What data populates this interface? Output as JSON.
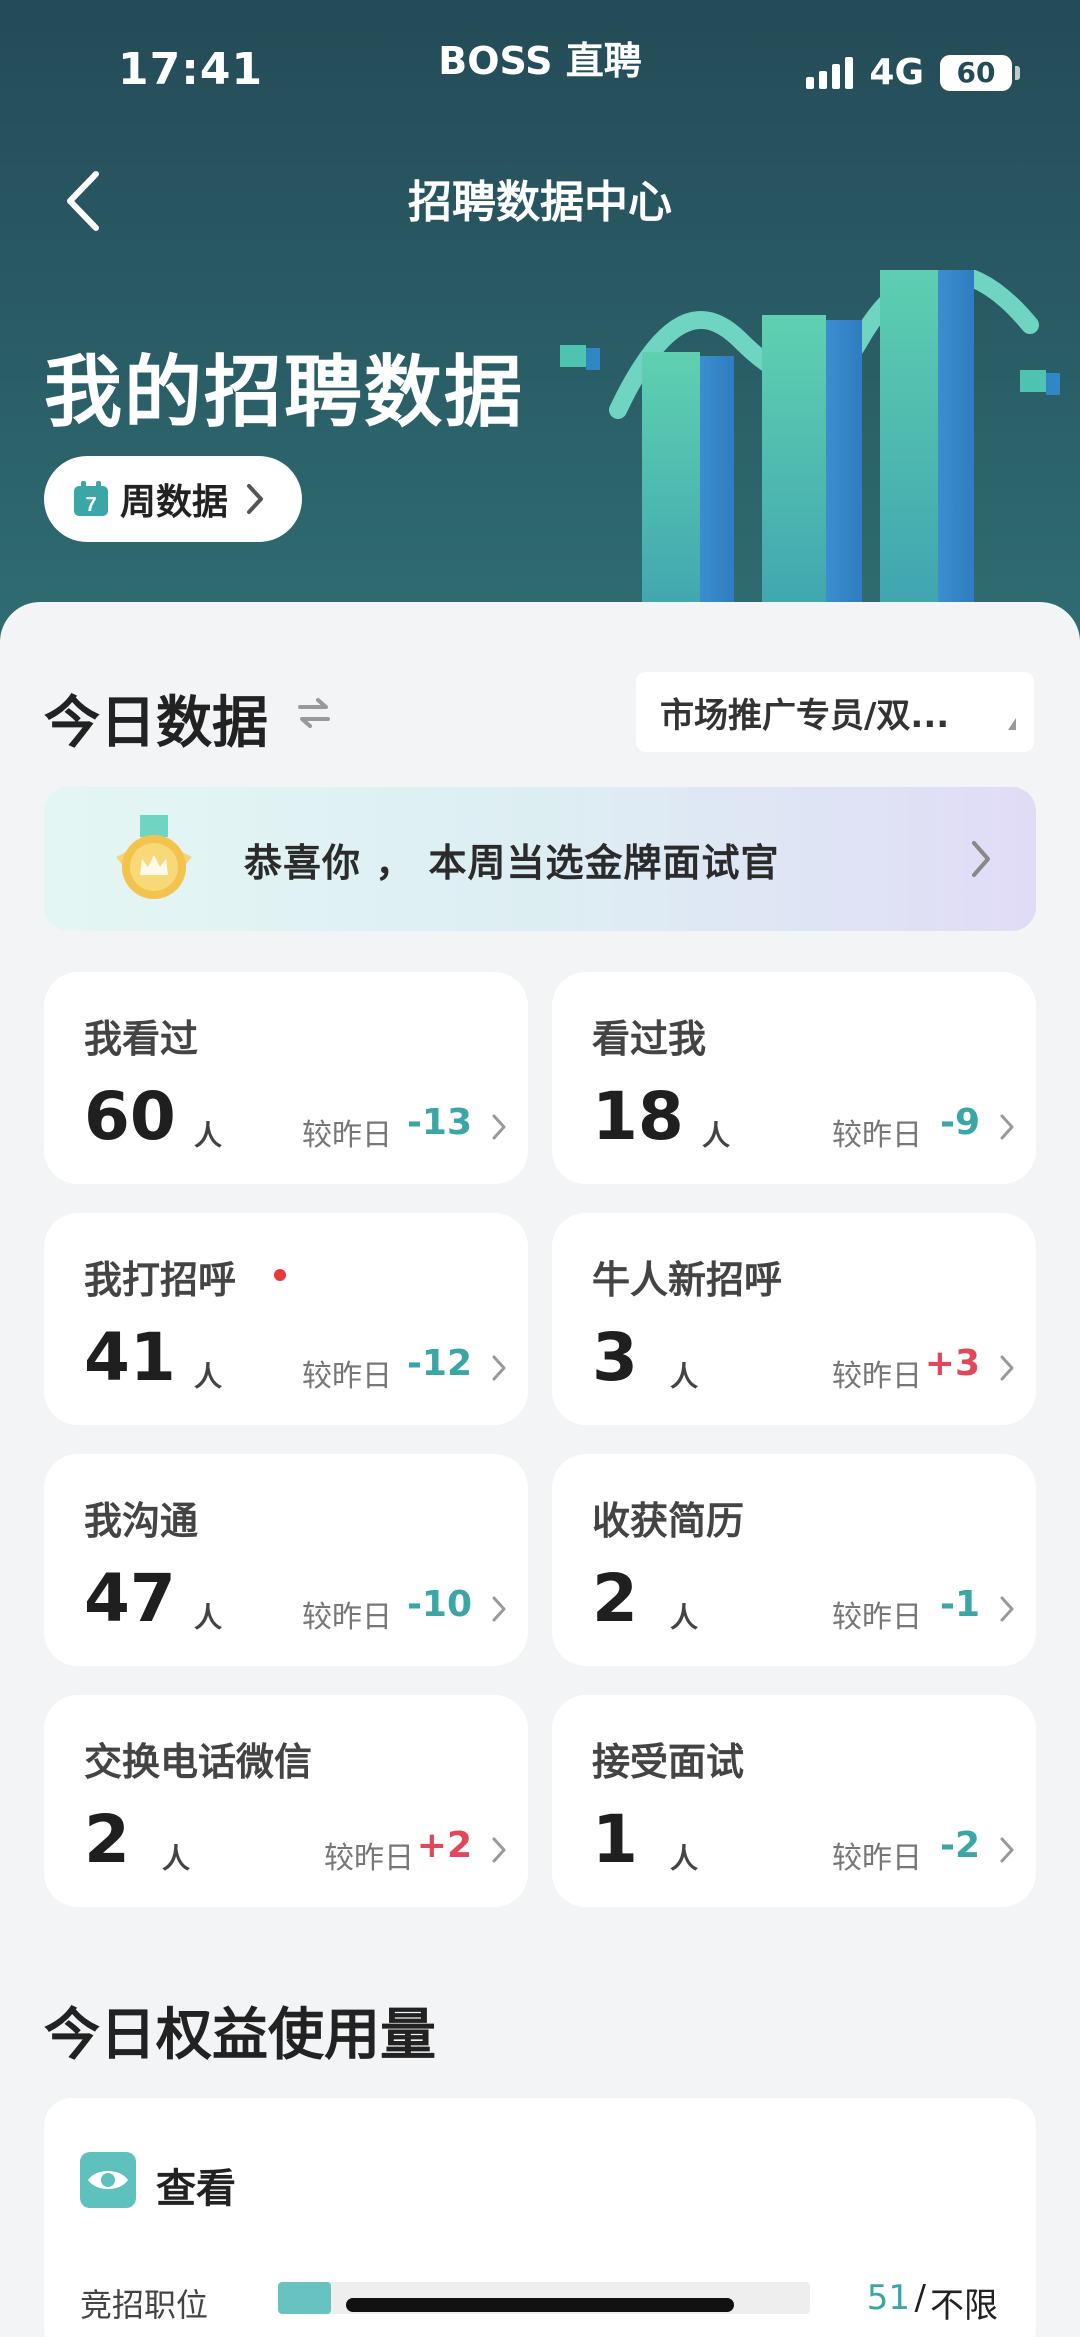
{
  "status_bar": {
    "time": "17:41",
    "carrier": "BOSS 直聘",
    "network": "4G",
    "battery": "60"
  },
  "header": {
    "title": "招聘数据中心",
    "hero_title": "我的招聘数据",
    "period_label": "周数据",
    "calendar_day": "7"
  },
  "today": {
    "title": "今日数据",
    "job_select": "市场推广专员/双...",
    "banner_text": "恭喜你 ， 本周当选金牌面试官",
    "compare_label": "较昨日",
    "unit": "人",
    "stats": [
      {
        "label": "我看过",
        "value": "60",
        "delta": "-13",
        "trend": "down"
      },
      {
        "label": "看过我",
        "value": "18",
        "delta": "-9",
        "trend": "down"
      },
      {
        "label": "我打招呼",
        "value": "41",
        "delta": "-12",
        "trend": "down",
        "has_dot": true
      },
      {
        "label": "牛人新招呼",
        "value": "3",
        "delta": "+3",
        "trend": "up"
      },
      {
        "label": "我沟通",
        "value": "47",
        "delta": "-10",
        "trend": "down"
      },
      {
        "label": "收获简历",
        "value": "2",
        "delta": "-1",
        "trend": "down"
      },
      {
        "label": "交换电话微信",
        "value": "2",
        "delta": "+2",
        "trend": "up"
      },
      {
        "label": "接受面试",
        "value": "1",
        "delta": "-2",
        "trend": "down"
      }
    ]
  },
  "benefits": {
    "title": "今日权益使用量",
    "card_title": "查看",
    "quota_label": "竞招职位",
    "quota_used": "51",
    "quota_limit": "不限",
    "quota_fill_fraction": 0.1
  },
  "colors": {
    "accent": "#3aa7a6",
    "negative_delta": "#3aa7a6",
    "positive_delta": "#e0485a",
    "header_bg": "#244b57"
  }
}
